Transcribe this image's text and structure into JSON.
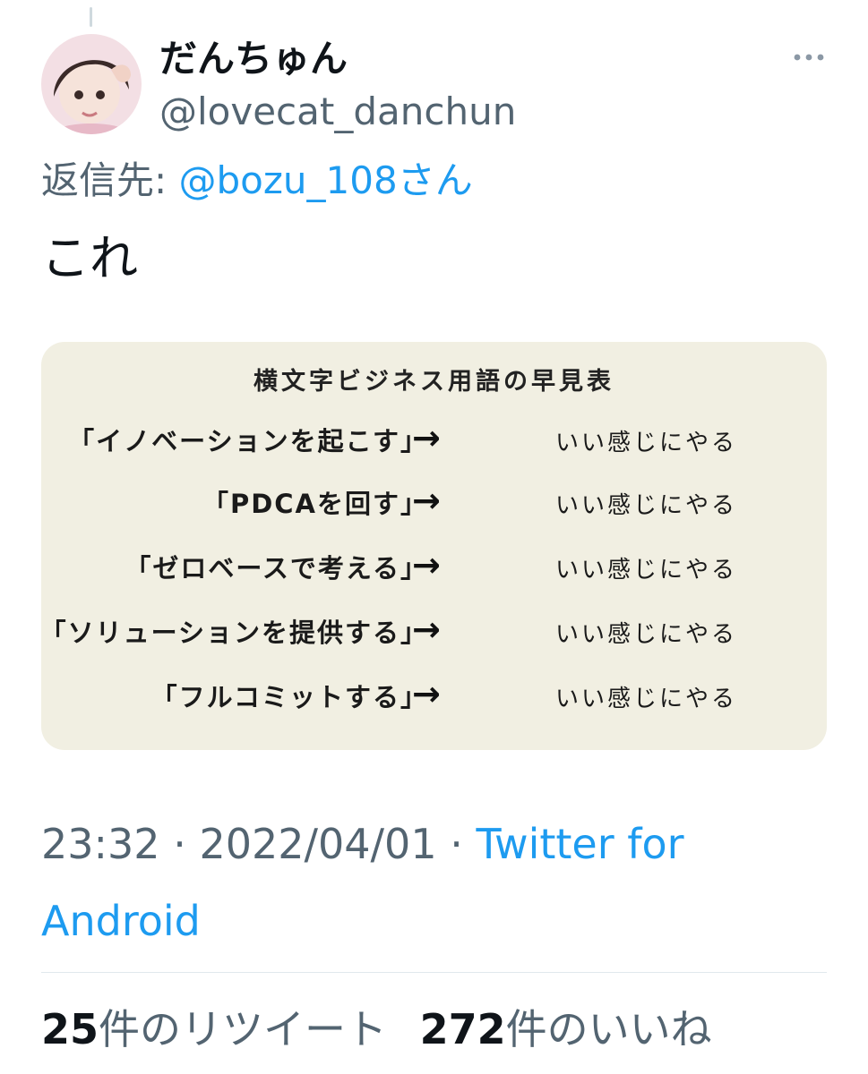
{
  "tweet": {
    "author": {
      "display_name": "だんちゅん",
      "handle": "@lovecat_danchun"
    },
    "reply": {
      "label": "返信先:",
      "handle": "@bozu_108さん"
    },
    "text": "これ",
    "media": {
      "title": "横文字ビジネス用語の早見表",
      "rows": [
        {
          "term": "「イノベーションを起こす」",
          "arrow": "→",
          "meaning": "いい感じにやる"
        },
        {
          "term": "「PDCAを回す」",
          "arrow": "→",
          "meaning": "いい感じにやる"
        },
        {
          "term": "「ゼロベースで考える」",
          "arrow": "→",
          "meaning": "いい感じにやる"
        },
        {
          "term": "「ソリューションを提供する」",
          "arrow": "→",
          "meaning": "いい感じにやる"
        },
        {
          "term": "「フルコミットする」",
          "arrow": "→",
          "meaning": "いい感じにやる"
        }
      ]
    },
    "meta": {
      "time": "23:32",
      "separator": " · ",
      "date": "2022/04/01",
      "separator2": " · ",
      "source": "Twitter for Android"
    },
    "stats": {
      "retweets_count": "25",
      "retweets_label": "件のリツイート",
      "likes_count": "272",
      "likes_label": "件のいいね"
    }
  },
  "colors": {
    "link": "#1d9bf0",
    "secondary_text": "#536471",
    "media_bg": "#f1efe2"
  },
  "icons": {
    "more": "more-horizontal-icon"
  }
}
